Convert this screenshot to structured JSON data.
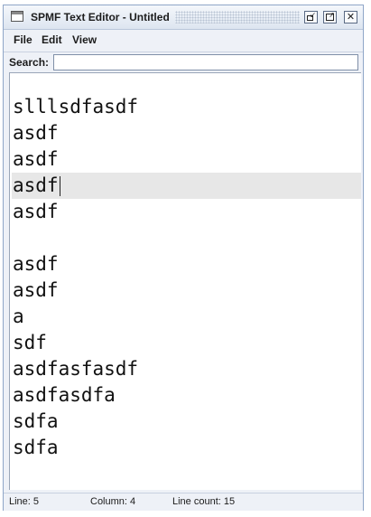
{
  "window": {
    "title": "SPMF Text Editor - Untitled"
  },
  "menu": {
    "file": "File",
    "edit": "Edit",
    "view": "View"
  },
  "search": {
    "label": "Search:",
    "value": "",
    "placeholder": ""
  },
  "editor": {
    "current_line_index": 3,
    "lines": [
      "slllsdfasdf",
      "asdf",
      "asdf",
      "asdf",
      "asdf",
      "",
      "asdf",
      "asdf",
      "a",
      "sdf",
      "asdfasfasdf",
      "asdfasdfa",
      "sdfa",
      "sdfa"
    ]
  },
  "status": {
    "line": "Line: 5",
    "column": "Column: 4",
    "line_count": "Line count: 15"
  },
  "icons": {
    "app": "window-icon",
    "minimize": "minimize-icon",
    "maximize": "maximize-icon",
    "close": "close-icon"
  }
}
